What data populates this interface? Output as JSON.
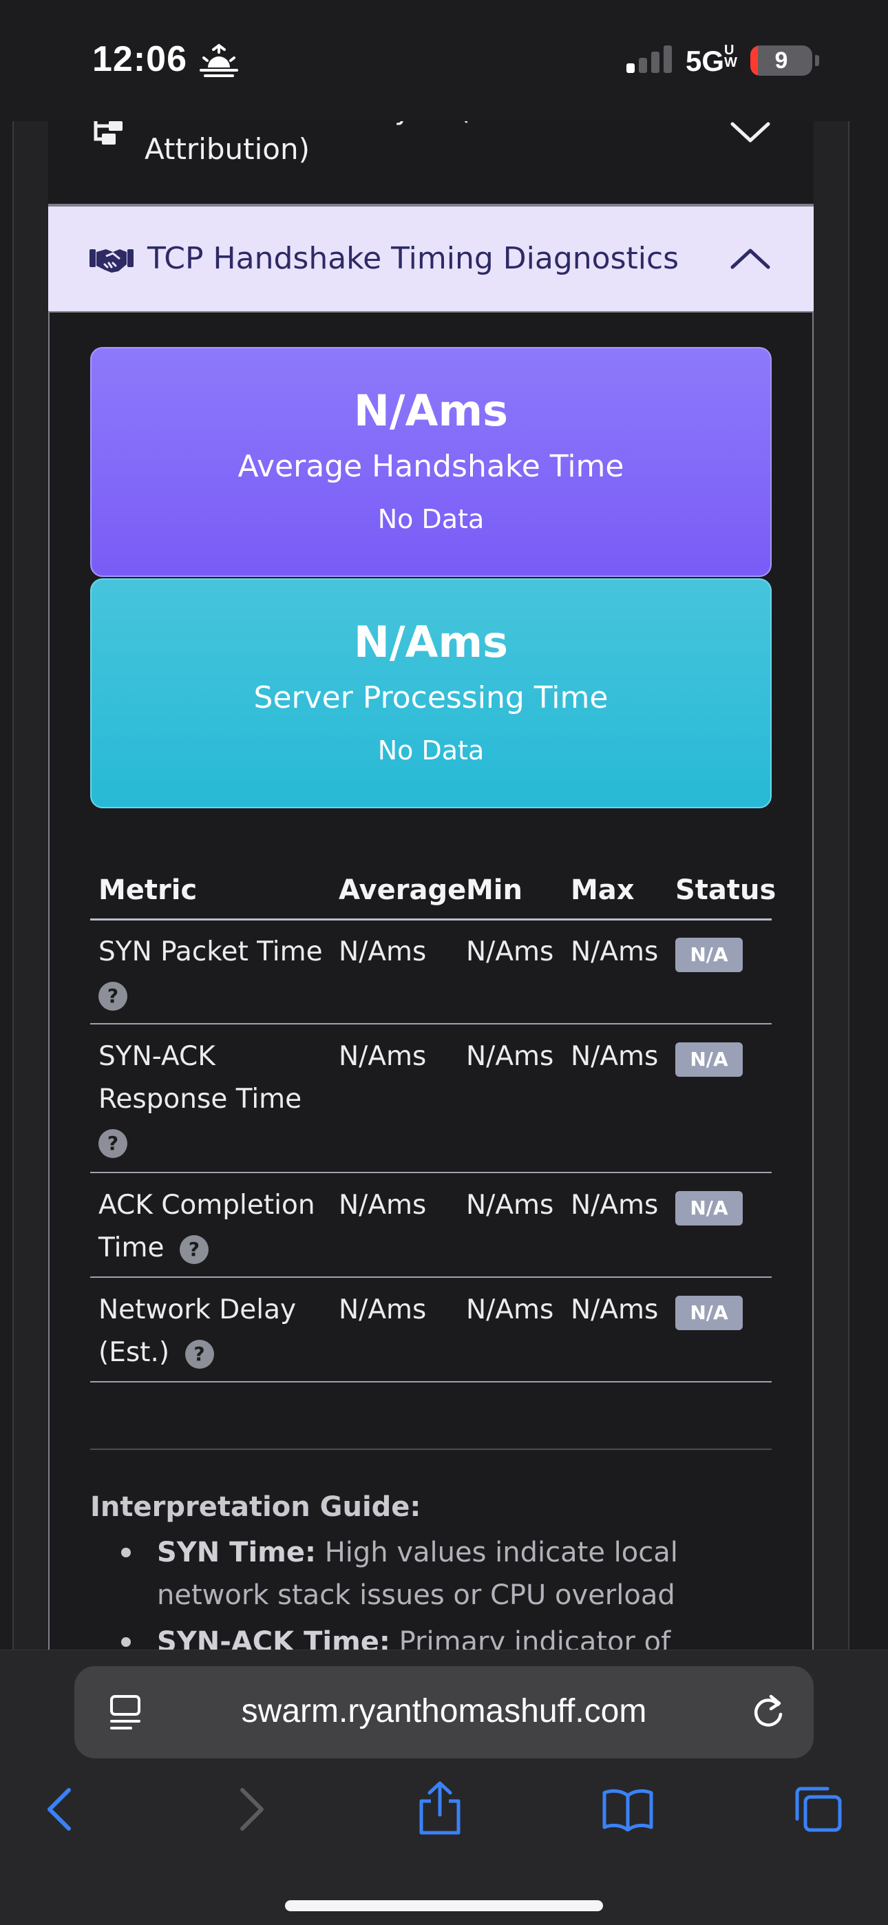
{
  "status_bar": {
    "time": "12:06",
    "network": "5G",
    "network_suffix": "UW",
    "battery_level": "9",
    "battery_fraction": 0.09
  },
  "accordion_previous": {
    "title": "TCP Window Analysis (Bottleneck Attribution)",
    "icon": "network-tree-icon"
  },
  "accordion_active": {
    "title": "TCP Handshake Timing Diagnostics",
    "icon": "handshake-icon"
  },
  "metric_cards": [
    {
      "value": "N/Ams",
      "label": "Average Handshake Time",
      "sub": "No Data",
      "color": "#7f66f8"
    },
    {
      "value": "N/Ams",
      "label": "Server Processing Time",
      "sub": "No Data",
      "color": "#33bdd8"
    }
  ],
  "table": {
    "headers": [
      "Metric",
      "Average",
      "Min",
      "Max",
      "Status"
    ],
    "rows": [
      {
        "metric_lines": [
          "SYN Packet Time",
          ""
        ],
        "average": "N/Ams",
        "min": "N/Ams",
        "max": "N/Ams",
        "status": "N/A"
      },
      {
        "metric_lines": [
          "SYN-ACK",
          "Response Time",
          ""
        ],
        "average": "N/Ams",
        "min": "N/Ams",
        "max": "N/Ams",
        "status": "N/A"
      },
      {
        "metric_lines": [
          "ACK Completion",
          "Time"
        ],
        "average": "N/Ams",
        "min": "N/Ams",
        "max": "N/Ams",
        "status": "N/A"
      },
      {
        "metric_lines": [
          "Network Delay",
          "(Est.)"
        ],
        "average": "N/Ams",
        "min": "N/Ams",
        "max": "N/Ams",
        "status": "N/A"
      }
    ],
    "help_glyph": "?"
  },
  "guide": {
    "title": "Interpretation Guide:",
    "items": [
      {
        "term": "SYN Time:",
        "text": " High values indicate local network stack issues or CPU overload"
      },
      {
        "term": "SYN-ACK Time:",
        "text": " Primary indicator of server"
      }
    ]
  },
  "browser": {
    "url": "swarm.ryanthomashuff.com",
    "accent": "#3a82f7"
  }
}
